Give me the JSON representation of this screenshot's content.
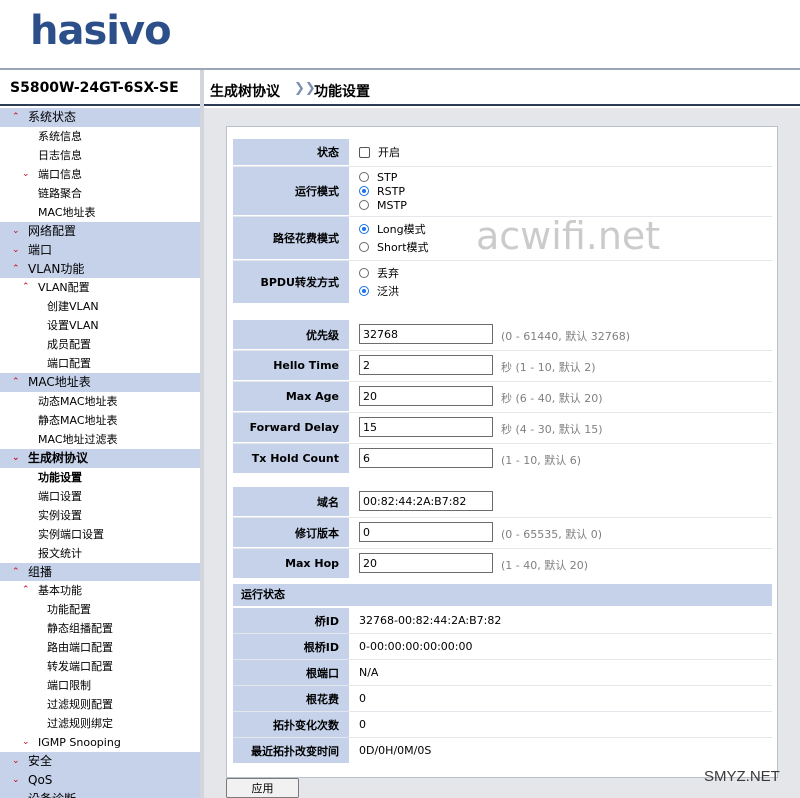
{
  "brand": {
    "logo": "hasivo",
    "model": "S5800W-24GT-6SX-SE"
  },
  "breadcrumb": {
    "section": "生成树协议",
    "separator": "❯❯",
    "page": "功能设置"
  },
  "sidebar": [
    {
      "label": "系统状态",
      "level": 0,
      "arrow": "up"
    },
    {
      "label": "系统信息",
      "level": 1
    },
    {
      "label": "日志信息",
      "level": 1
    },
    {
      "label": "端口信息",
      "level": 1,
      "arrow": "down"
    },
    {
      "label": "链路聚合",
      "level": 1
    },
    {
      "label": "MAC地址表",
      "level": 1
    },
    {
      "label": "网络配置",
      "level": 0,
      "arrow": "down"
    },
    {
      "label": "端口",
      "level": 0,
      "arrow": "down"
    },
    {
      "label": "VLAN功能",
      "level": 0,
      "arrow": "up"
    },
    {
      "label": "VLAN配置",
      "level": 1,
      "arrow": "up"
    },
    {
      "label": "创建VLAN",
      "level": 2
    },
    {
      "label": "设置VLAN",
      "level": 2
    },
    {
      "label": "成员配置",
      "level": 2
    },
    {
      "label": "端口配置",
      "level": 2
    },
    {
      "label": "MAC地址表",
      "level": 0,
      "arrow": "up"
    },
    {
      "label": "动态MAC地址表",
      "level": 1
    },
    {
      "label": "静态MAC地址表",
      "level": 1
    },
    {
      "label": "MAC地址过滤表",
      "level": 1
    },
    {
      "label": "生成树协议",
      "level": 0,
      "arrow": "down",
      "active": true
    },
    {
      "label": "功能设置",
      "level": 1,
      "selected": true
    },
    {
      "label": "端口设置",
      "level": 1
    },
    {
      "label": "实例设置",
      "level": 1
    },
    {
      "label": "实例端口设置",
      "level": 1
    },
    {
      "label": "报文统计",
      "level": 1
    },
    {
      "label": "组播",
      "level": 0,
      "arrow": "up"
    },
    {
      "label": "基本功能",
      "level": 1,
      "arrow": "up"
    },
    {
      "label": "功能配置",
      "level": 2
    },
    {
      "label": "静态组播配置",
      "level": 2
    },
    {
      "label": "路由端口配置",
      "level": 2
    },
    {
      "label": "转发端口配置",
      "level": 2
    },
    {
      "label": "端口限制",
      "level": 2
    },
    {
      "label": "过滤规则配置",
      "level": 2
    },
    {
      "label": "过滤规则绑定",
      "level": 2
    },
    {
      "label": "IGMP Snooping",
      "level": 1,
      "arrow": "down"
    },
    {
      "label": "安全",
      "level": 0,
      "arrow": "down"
    },
    {
      "label": "QoS",
      "level": 0,
      "arrow": "down"
    },
    {
      "label": "设备诊断",
      "level": 0,
      "arrow": "down"
    }
  ],
  "form": {
    "status": {
      "label": "状态",
      "option": "开启",
      "checked": false
    },
    "mode": {
      "label": "运行模式",
      "options": [
        "STP",
        "RSTP",
        "MSTP"
      ],
      "selected": "RSTP"
    },
    "pathcost": {
      "label": "路径花费模式",
      "options": [
        "Long模式",
        "Short模式"
      ],
      "selected": "Long模式"
    },
    "bpdu": {
      "label": "BPDU转发方式",
      "options": [
        "丢弃",
        "泛洪"
      ],
      "selected": "泛洪"
    },
    "priority": {
      "label": "优先级",
      "value": "32768",
      "hint": "(0 - 61440, 默认 32768)"
    },
    "hello": {
      "label": "Hello Time",
      "value": "2",
      "hint": "秒 (1 - 10, 默认 2)"
    },
    "maxage": {
      "label": "Max Age",
      "value": "20",
      "hint": "秒 (6 - 40, 默认 20)"
    },
    "fwddelay": {
      "label": "Forward Delay",
      "value": "15",
      "hint": "秒 (4 - 30, 默认 15)"
    },
    "txhold": {
      "label": "Tx Hold Count",
      "value": "6",
      "hint": "(1 - 10, 默认 6)"
    },
    "domain": {
      "label": "域名",
      "value": "00:82:44:2A:B7:82"
    },
    "revision": {
      "label": "修订版本",
      "value": "0",
      "hint": "(0 - 65535, 默认 0)"
    },
    "maxhop": {
      "label": "Max Hop",
      "value": "20",
      "hint": "(1 - 40, 默认 20)"
    }
  },
  "runstatus": {
    "title": "运行状态",
    "rows": [
      {
        "label": "桥ID",
        "value": "32768-00:82:44:2A:B7:82"
      },
      {
        "label": "根桥ID",
        "value": "0-00:00:00:00:00:00"
      },
      {
        "label": "根端口",
        "value": "N/A"
      },
      {
        "label": "根花费",
        "value": "0"
      },
      {
        "label": "拓扑变化次数",
        "value": "0"
      },
      {
        "label": "最近拓扑改变时间",
        "value": "0D/0H/0M/0S"
      }
    ]
  },
  "apply_label": "应用",
  "watermarks": {
    "center": "acwifi.net",
    "corner": "SMYZ.NET"
  },
  "colors": {
    "accent_bg": "#c5d2ea",
    "logo": "#2c4f8a",
    "arrow": "#d0021b"
  }
}
